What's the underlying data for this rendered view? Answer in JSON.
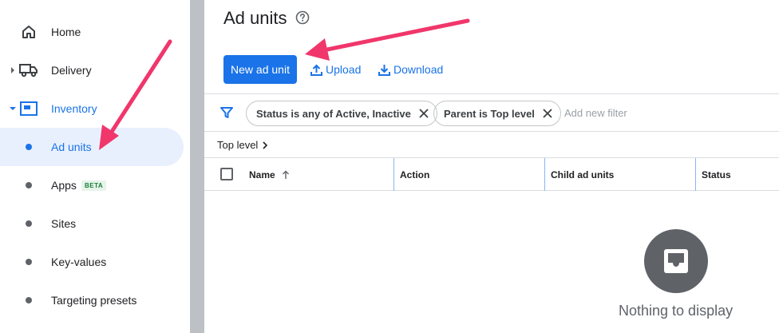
{
  "sidebar": {
    "items": [
      {
        "label": "Home",
        "icon": "home-icon"
      },
      {
        "label": "Delivery",
        "icon": "truck-icon"
      },
      {
        "label": "Inventory",
        "icon": "inventory-icon"
      },
      {
        "label": "Ad units"
      },
      {
        "label": "Apps",
        "badge": "BETA"
      },
      {
        "label": "Sites"
      },
      {
        "label": "Key-values"
      },
      {
        "label": "Targeting presets"
      }
    ]
  },
  "main": {
    "title": "Ad units",
    "buttons": {
      "new": "New ad unit",
      "upload": "Upload",
      "download": "Download"
    },
    "filters": {
      "chips": [
        "Status is any of Active, Inactive",
        "Parent is Top level"
      ],
      "add_placeholder": "Add new filter"
    },
    "breadcrumb": "Top level",
    "table": {
      "columns": [
        "Name",
        "Action",
        "Child ad units",
        "Status"
      ]
    },
    "empty_state": "Nothing to display"
  },
  "colors": {
    "accent": "#1a73e8",
    "annotation_arrow": "#f0366b",
    "selected_bg": "#e8f0fe"
  }
}
